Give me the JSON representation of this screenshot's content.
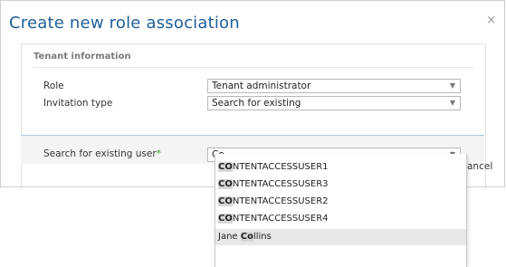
{
  "dialog": {
    "title": "Create new role association",
    "close_glyph": "×"
  },
  "tenant_section": {
    "heading": "Tenant information",
    "role_label": "Role",
    "role_value": "Tenant administrator",
    "invitation_label": "Invitation type",
    "invitation_value": "Search for existing"
  },
  "search": {
    "label": "Search for existing user",
    "required_mark": "*",
    "value": "Co"
  },
  "cancel_label_partial": "ancel",
  "dropdown": {
    "match_prefix_upper": "CO",
    "match_prefix_mixed": "Co",
    "options": [
      {
        "highlight": "CO",
        "rest": "NTENTACCESSUSER1"
      },
      {
        "highlight": "CO",
        "rest": "NTENTACCESSUSER3"
      },
      {
        "highlight": "CO",
        "rest": "NTENTACCESSUSER2"
      },
      {
        "highlight": "CO",
        "rest": "NTENTACCESSUSER4"
      },
      {
        "prefix": "Jane ",
        "highlight": "Co",
        "rest": "llins",
        "active": true
      }
    ]
  },
  "colors": {
    "title": "#1f5f99",
    "required": "#3a9a3a",
    "highlight_bg": "#d6d6d6",
    "active_row_bg": "#e8e8e8"
  }
}
